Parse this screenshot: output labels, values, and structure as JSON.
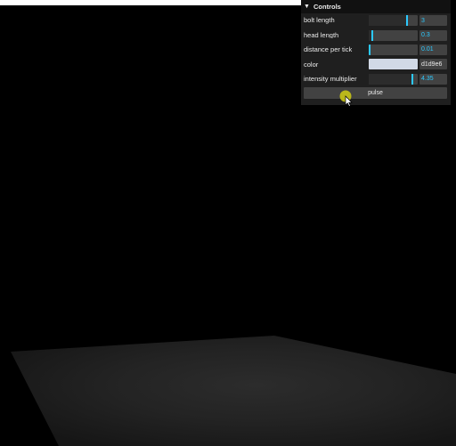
{
  "gui": {
    "title": "Controls",
    "controllers": [
      {
        "label": "bolt length",
        "value": "3",
        "fraction": 0.76
      },
      {
        "label": "head length",
        "value": "0.3",
        "fraction": 0.06
      },
      {
        "label": "distance per tick",
        "value": "0.01",
        "fraction": 0.0
      }
    ],
    "color": {
      "label": "color",
      "hex": "d1d9e6",
      "swatch": "#d1d9e6"
    },
    "intensity": {
      "label": "intensity multiplier",
      "value": "4.35",
      "fraction": 0.87
    },
    "pulse_label": "pulse"
  },
  "accent": "#2cc9ff",
  "cursor_highlight": "#c8c417"
}
